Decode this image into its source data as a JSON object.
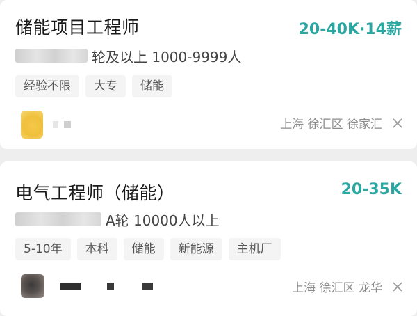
{
  "jobs": [
    {
      "title": "储能项目工程师",
      "salary": "20-40K·14薪",
      "company_info": "轮及以上 1000-9999人",
      "tags": [
        "经验不限",
        "大专",
        "储能"
      ],
      "location": "上海 徐汇区 徐家汇"
    },
    {
      "title": "电气工程师（储能）",
      "salary": "20-35K",
      "company_info": "A轮 10000人以上",
      "tags": [
        "5-10年",
        "本科",
        "储能",
        "新能源",
        "主机厂"
      ],
      "location": "上海 徐汇区 龙华"
    }
  ],
  "icons": {
    "dismiss": "close-icon"
  },
  "colors": {
    "salary": "#2aa7a0",
    "background": "#eeeeee",
    "card": "#ffffff"
  }
}
